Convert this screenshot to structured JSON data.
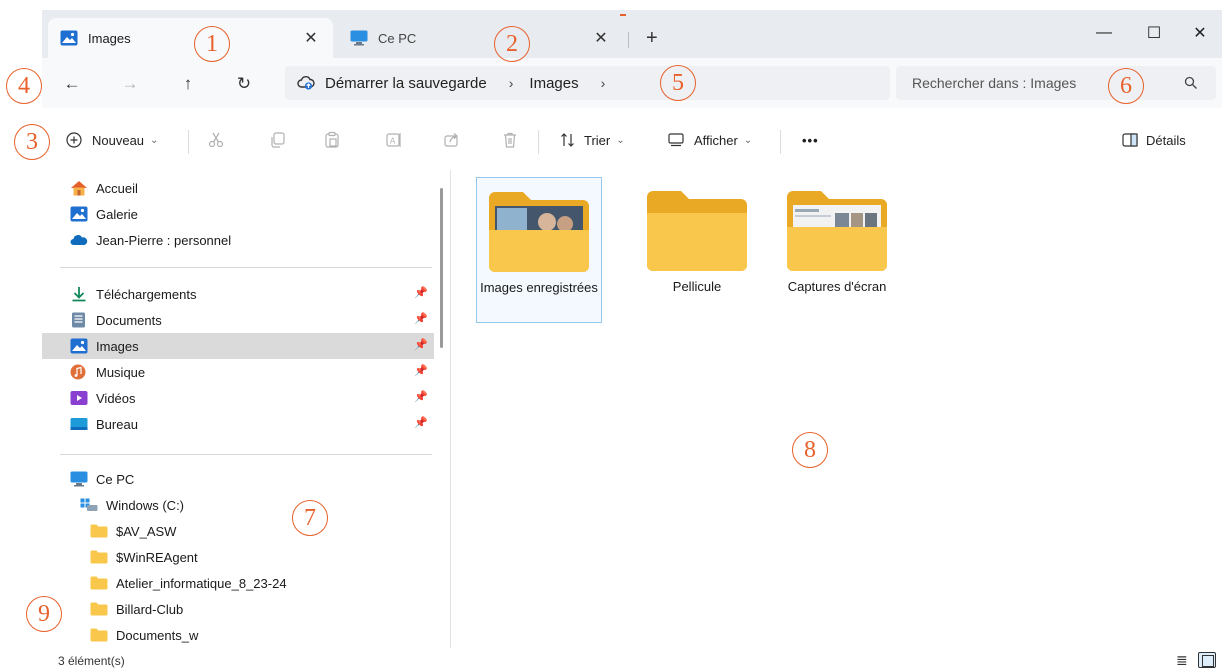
{
  "tabs": [
    {
      "label": "Images",
      "icon": "images-folder-icon",
      "active": true
    },
    {
      "label": "Ce PC",
      "icon": "monitor-icon",
      "active": false
    }
  ],
  "window_controls": {
    "minimize": "—",
    "maximize": "☐",
    "close": "✕"
  },
  "new_tab_symbol": "+",
  "tab_close_symbol": "✕",
  "nav": {
    "back": "←",
    "forward": "→",
    "up": "↑",
    "refresh": "↻"
  },
  "breadcrumb": {
    "items": [
      "Démarrer la sauvegarde",
      "Images"
    ],
    "separator": "›"
  },
  "search": {
    "placeholder": "Rechercher dans : Images"
  },
  "commandbar": {
    "new_label": "Nouveau",
    "sort_label": "Trier",
    "view_label": "Afficher",
    "more_label": "•••",
    "details_label": "Détails"
  },
  "sidebar": {
    "quick": [
      {
        "label": "Accueil",
        "icon": "home-icon"
      },
      {
        "label": "Galerie",
        "icon": "gallery-icon"
      },
      {
        "label": "Jean-Pierre : personnel",
        "icon": "onedrive-cloud-icon"
      }
    ],
    "pinned": [
      {
        "label": "Téléchargements",
        "icon": "download-icon",
        "pinned": true
      },
      {
        "label": "Documents",
        "icon": "documents-icon",
        "pinned": true
      },
      {
        "label": "Images",
        "icon": "images-folder-icon",
        "pinned": true,
        "selected": true
      },
      {
        "label": "Musique",
        "icon": "music-icon",
        "pinned": true
      },
      {
        "label": "Vidéos",
        "icon": "videos-icon",
        "pinned": true
      },
      {
        "label": "Bureau",
        "icon": "desktop-icon",
        "pinned": true
      }
    ],
    "this_pc": {
      "label": "Ce PC",
      "icon": "monitor-icon"
    },
    "drive": {
      "label": "Windows (C:)",
      "icon": "drive-icon"
    },
    "folders": [
      "$AV_ASW",
      "$WinREAgent",
      "Atelier_informatique_8_23-24",
      "Billard-Club",
      "Documents_w"
    ]
  },
  "content": {
    "items": [
      {
        "label": "Images enregistrées",
        "selected": true
      },
      {
        "label": "Pellicule",
        "selected": false
      },
      {
        "label": "Captures d'écran",
        "selected": false
      }
    ]
  },
  "status": {
    "count": "3 élément(s)"
  },
  "annotations": [
    "1",
    "2",
    "3",
    "4",
    "5",
    "6",
    "7",
    "8",
    "9"
  ],
  "colors": {
    "titlebar_bg": "#e8ebef",
    "annotation": "#e8612c",
    "folder_yellow": "#f8c74b",
    "selection_border": "#98c7ec"
  }
}
